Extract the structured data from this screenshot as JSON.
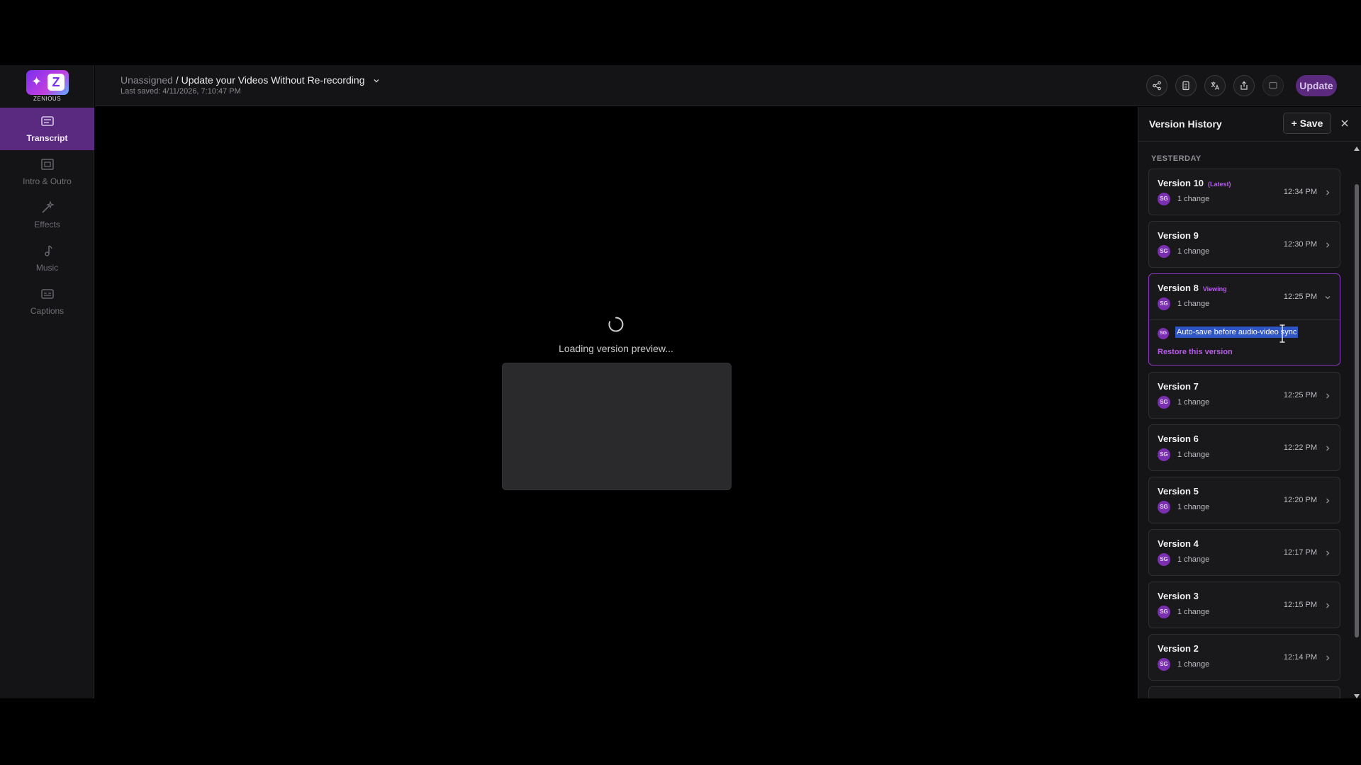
{
  "sidebar": {
    "logo_text": "ZENIOUS",
    "items": [
      {
        "label": "Transcript",
        "icon": "transcript-icon",
        "active": true
      },
      {
        "label": "Intro & Outro",
        "icon": "film-frame-icon",
        "active": false
      },
      {
        "label": "Effects",
        "icon": "magic-wand-icon",
        "active": false
      },
      {
        "label": "Music",
        "icon": "music-note-icon",
        "active": false
      },
      {
        "label": "Captions",
        "icon": "captions-icon",
        "active": false
      }
    ]
  },
  "header": {
    "project": "Unassigned",
    "separator": " / ",
    "title": "Update your Videos Without Re-recording",
    "last_saved": "Last saved: 4/11/2026, 7:10:47 PM",
    "update_label": "Update",
    "icons": [
      "share-icon",
      "document-icon",
      "translate-icon",
      "export-icon",
      "comment-icon"
    ]
  },
  "preview": {
    "loading_text": "Loading version preview..."
  },
  "version_history": {
    "title": "Version History",
    "save_label": "Save",
    "group_label": "YESTERDAY",
    "versions": [
      {
        "name": "Version 10",
        "tag": "(Latest)",
        "initials": "SG",
        "changes": "1 change",
        "time": "12:34 PM"
      },
      {
        "name": "Version 9",
        "tag": "",
        "initials": "SG",
        "changes": "1 change",
        "time": "12:30 PM"
      },
      {
        "name": "Version 8",
        "tag": "Viewing",
        "initials": "SG",
        "changes": "1 change",
        "time": "12:25 PM",
        "note": "Auto-save before audio-video sync",
        "restore_label": "Restore this version"
      },
      {
        "name": "Version 7",
        "tag": "",
        "initials": "SG",
        "changes": "1 change",
        "time": "12:25 PM"
      },
      {
        "name": "Version 6",
        "tag": "",
        "initials": "SG",
        "changes": "1 change",
        "time": "12:22 PM"
      },
      {
        "name": "Version 5",
        "tag": "",
        "initials": "SG",
        "changes": "1 change",
        "time": "12:20 PM"
      },
      {
        "name": "Version 4",
        "tag": "",
        "initials": "SG",
        "changes": "1 change",
        "time": "12:17 PM"
      },
      {
        "name": "Version 3",
        "tag": "",
        "initials": "SG",
        "changes": "1 change",
        "time": "12:15 PM"
      },
      {
        "name": "Version 2",
        "tag": "",
        "initials": "SG",
        "changes": "1 change",
        "time": "12:14 PM"
      }
    ]
  },
  "colors": {
    "accent": "#7a2fb0",
    "active_nav": "#5a2a80",
    "selection": "#2e55c6"
  }
}
